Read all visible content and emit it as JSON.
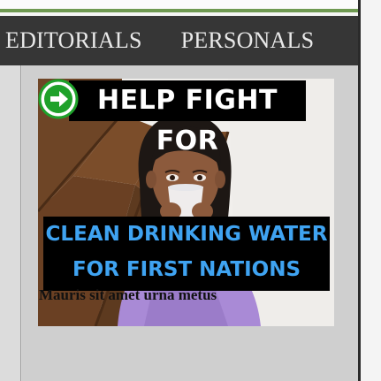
{
  "nav": {
    "items": [
      {
        "label": "EDITORIALS"
      },
      {
        "label": "PERSONALS"
      }
    ]
  },
  "ad": {
    "title": "HELP FIGHT FOR",
    "subtitle_line1": "CLEAN DRINKING WATER",
    "subtitle_line2": "FOR FIRST NATIONS",
    "icon": "play-arrow-icon",
    "colors": {
      "accent_text": "#3fa3f1",
      "icon": "#1ea12a"
    }
  },
  "article": {
    "headline": "Mauris sit amet urna metus"
  },
  "colors": {
    "navbar": "#363636",
    "nav_text": "#e9e9e9",
    "accent_line": "#6f9a52"
  }
}
